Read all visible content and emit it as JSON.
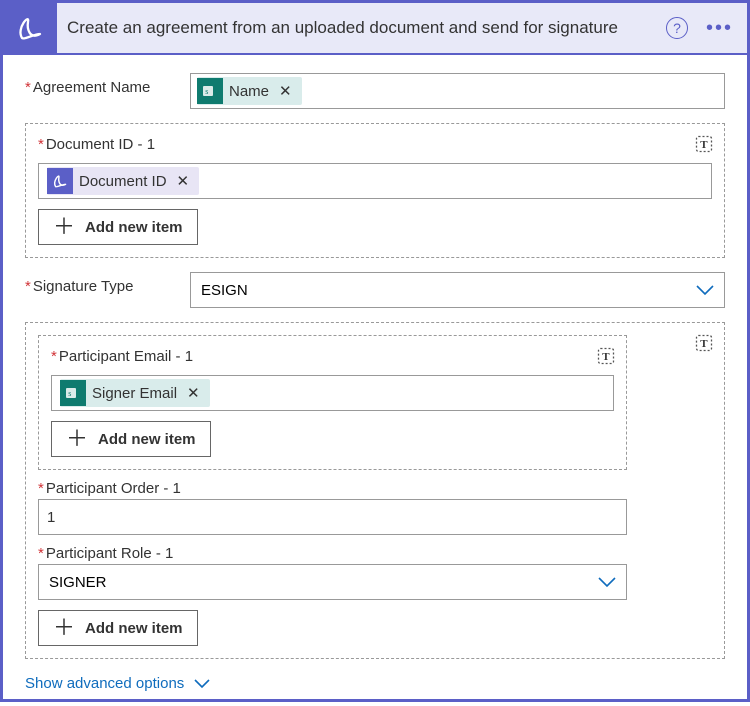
{
  "header": {
    "title": "Create an agreement from an uploaded document and send for signature"
  },
  "labels": {
    "agreement_name": "Agreement Name",
    "signature_type": "Signature Type"
  },
  "pills": {
    "name": "Name",
    "document_id": "Document ID",
    "signer_email": "Signer Email"
  },
  "group_doc": {
    "label": "Document ID - 1",
    "add": "Add new item"
  },
  "signature_type_value": "ESIGN",
  "group_participant": {
    "email_label": "Participant Email - 1",
    "email_add": "Add new item",
    "order_label": "Participant Order - 1",
    "order_value": "1",
    "role_label": "Participant Role - 1",
    "role_value": "SIGNER",
    "outer_add": "Add new item"
  },
  "advanced": "Show advanced options"
}
